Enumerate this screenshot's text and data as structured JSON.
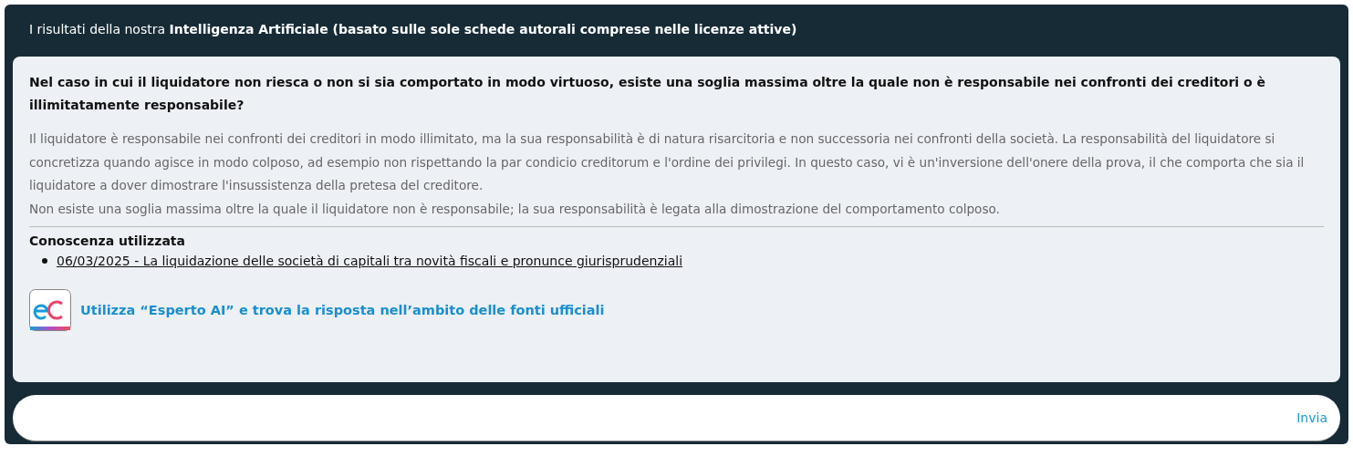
{
  "header": {
    "text": "I risultati della nostra **Intelligenza Artificiale (basato sulle sole schede autorali comprese nelle licenze attive)**"
  },
  "answer": {
    "question": "Nel caso in cui il liquidatore non riesca o non si sia comportato in modo virtuoso, esiste una soglia massima oltre la quale non è responsabile nei confronti dei creditori o è illimitatamente responsabile?",
    "paragraphs": [
      "Il liquidatore è responsabile nei confronti dei creditori in modo illimitato, ma la sua responsabilità è di natura risarcitoria e non successoria nei confronti della società. La responsabilità del liquidatore si concretizza quando agisce in modo colposo, ad esempio non rispettando la par condicio creditorum e l'ordine dei privilegi. In questo caso, vi è un'inversione dell'onere della prova, il che comporta che sia il liquidatore a dover dimostrare l'insussistenza della pretesa del creditore.",
      "Non esiste una soglia massima oltre la quale il liquidatore non è responsabile; la sua responsabilità è legata alla dimostrazione del comportamento colposo."
    ],
    "sources_title": "Conoscenza utilizzata",
    "sources": [
      "06/03/2025 - La liquidazione delle società di capitali tra novità fiscali e pronunce giurisprudenziali"
    ],
    "promo": "Utilizza “Esperto AI” e trova la risposta nell’ambito delle fonti ufficiali"
  },
  "input": {
    "button": "Invia"
  }
}
